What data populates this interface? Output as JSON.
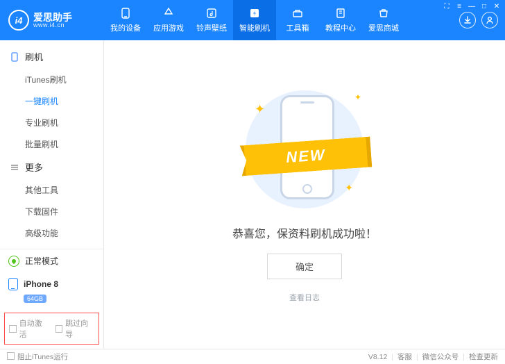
{
  "app": {
    "name_cn": "爱思助手",
    "name_en": "www.i4.cn",
    "logo_text": "i4"
  },
  "window_buttons": {
    "tshirt": "⛶",
    "menu": "≡",
    "min": "—",
    "max": "□",
    "close": "✕"
  },
  "header_icons": {
    "download": "↓",
    "user": "○"
  },
  "nav": [
    {
      "label": "我的设备",
      "icon": "phone"
    },
    {
      "label": "应用游戏",
      "icon": "apps"
    },
    {
      "label": "铃声壁纸",
      "icon": "music"
    },
    {
      "label": "智能刷机",
      "icon": "flash",
      "active": true
    },
    {
      "label": "工具箱",
      "icon": "toolbox"
    },
    {
      "label": "教程中心",
      "icon": "book"
    },
    {
      "label": "爱思商城",
      "icon": "shop"
    }
  ],
  "sidebar": {
    "sections": [
      {
        "title": "刷机",
        "items": [
          {
            "label": "iTunes刷机"
          },
          {
            "label": "一键刷机",
            "active": true
          },
          {
            "label": "专业刷机"
          },
          {
            "label": "批量刷机"
          }
        ]
      },
      {
        "title": "更多",
        "items": [
          {
            "label": "其他工具"
          },
          {
            "label": "下载固件"
          },
          {
            "label": "高级功能"
          }
        ]
      }
    ],
    "mode": "正常模式",
    "device": {
      "name": "iPhone 8",
      "storage": "64GB"
    },
    "options": {
      "auto_activate": "自动激活",
      "skip_guide": "跳过向导"
    }
  },
  "main": {
    "ribbon": "NEW",
    "success": "恭喜您，保资料刷机成功啦！",
    "confirm": "确定",
    "view_log": "查看日志"
  },
  "footer": {
    "block_itunes": "阻止iTunes运行",
    "version": "V8.12",
    "support": "客服",
    "wechat": "微信公众号",
    "update": "检查更新"
  }
}
